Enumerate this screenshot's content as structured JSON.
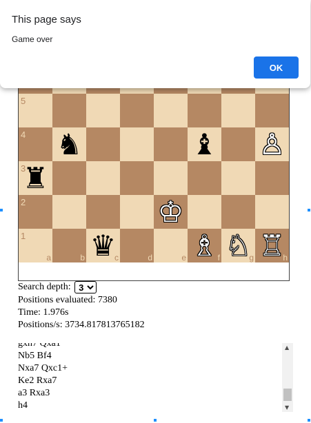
{
  "dialog": {
    "title": "This page says",
    "message": "Game over",
    "ok_label": "OK",
    "ok_color": "#1a73e8"
  },
  "board": {
    "light_color": "#f0d9b5",
    "dark_color": "#b58863",
    "rank_labels": [
      "5",
      "4",
      "3",
      "2",
      "1"
    ],
    "file_labels": [
      "a",
      "b",
      "c",
      "d",
      "e",
      "f",
      "g",
      "h"
    ],
    "pieces": [
      {
        "square": "b4",
        "glyph": "♞",
        "name": "black-knight-icon",
        "color": "black"
      },
      {
        "square": "f4",
        "glyph": "♝",
        "name": "black-bishop-icon",
        "color": "black"
      },
      {
        "square": "h4",
        "glyph": "♙",
        "name": "white-pawn-icon",
        "color": "white"
      },
      {
        "square": "a3",
        "glyph": "♜",
        "name": "black-rook-icon",
        "color": "black"
      },
      {
        "square": "e2",
        "glyph": "♔",
        "name": "white-king-icon",
        "color": "white"
      },
      {
        "square": "c1",
        "glyph": "♛",
        "name": "black-queen-icon",
        "color": "black"
      },
      {
        "square": "f1",
        "glyph": "♗",
        "name": "white-bishop-icon",
        "color": "white"
      },
      {
        "square": "g1",
        "glyph": "♘",
        "name": "white-knight-icon",
        "color": "white"
      },
      {
        "square": "h1",
        "glyph": "♖",
        "name": "white-rook-icon",
        "color": "white"
      }
    ]
  },
  "controls": {
    "depth_label": "Search depth:",
    "depth_value": "3",
    "positions_text": "Positions evaluated: 7380",
    "time_text": "Time: 1.976s",
    "speed_text": "Positions/s: 3734.817813765182"
  },
  "moves": [
    "gxh7 Qxa1",
    "Nb5 Bf4",
    "Nxa7 Qxc1+",
    "Ke2 Rxa7",
    "a3 Rxa3",
    "h4"
  ]
}
